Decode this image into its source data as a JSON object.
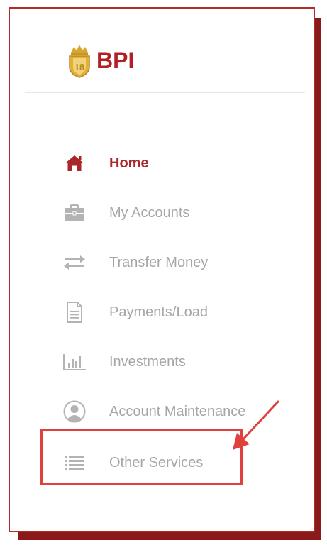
{
  "brand": {
    "name": "BPI",
    "crest_icon": "bpi-crest-icon",
    "color": "#b21f24"
  },
  "colors": {
    "active": "#a9262a",
    "inactive": "#a6a6a6",
    "highlight": "#e0413d",
    "frame_border": "#b22a2a"
  },
  "nav": {
    "items": [
      {
        "label": "Home",
        "icon": "home-icon",
        "active": true
      },
      {
        "label": "My Accounts",
        "icon": "briefcase-icon",
        "active": false
      },
      {
        "label": "Transfer Money",
        "icon": "transfer-arrows-icon",
        "active": false
      },
      {
        "label": "Payments/Load",
        "icon": "document-icon",
        "active": false
      },
      {
        "label": "Investments",
        "icon": "bar-chart-icon",
        "active": false
      },
      {
        "label": "Account Maintenance",
        "icon": "user-circle-icon",
        "active": false
      },
      {
        "label": "Other Services",
        "icon": "list-icon",
        "active": false
      }
    ]
  }
}
